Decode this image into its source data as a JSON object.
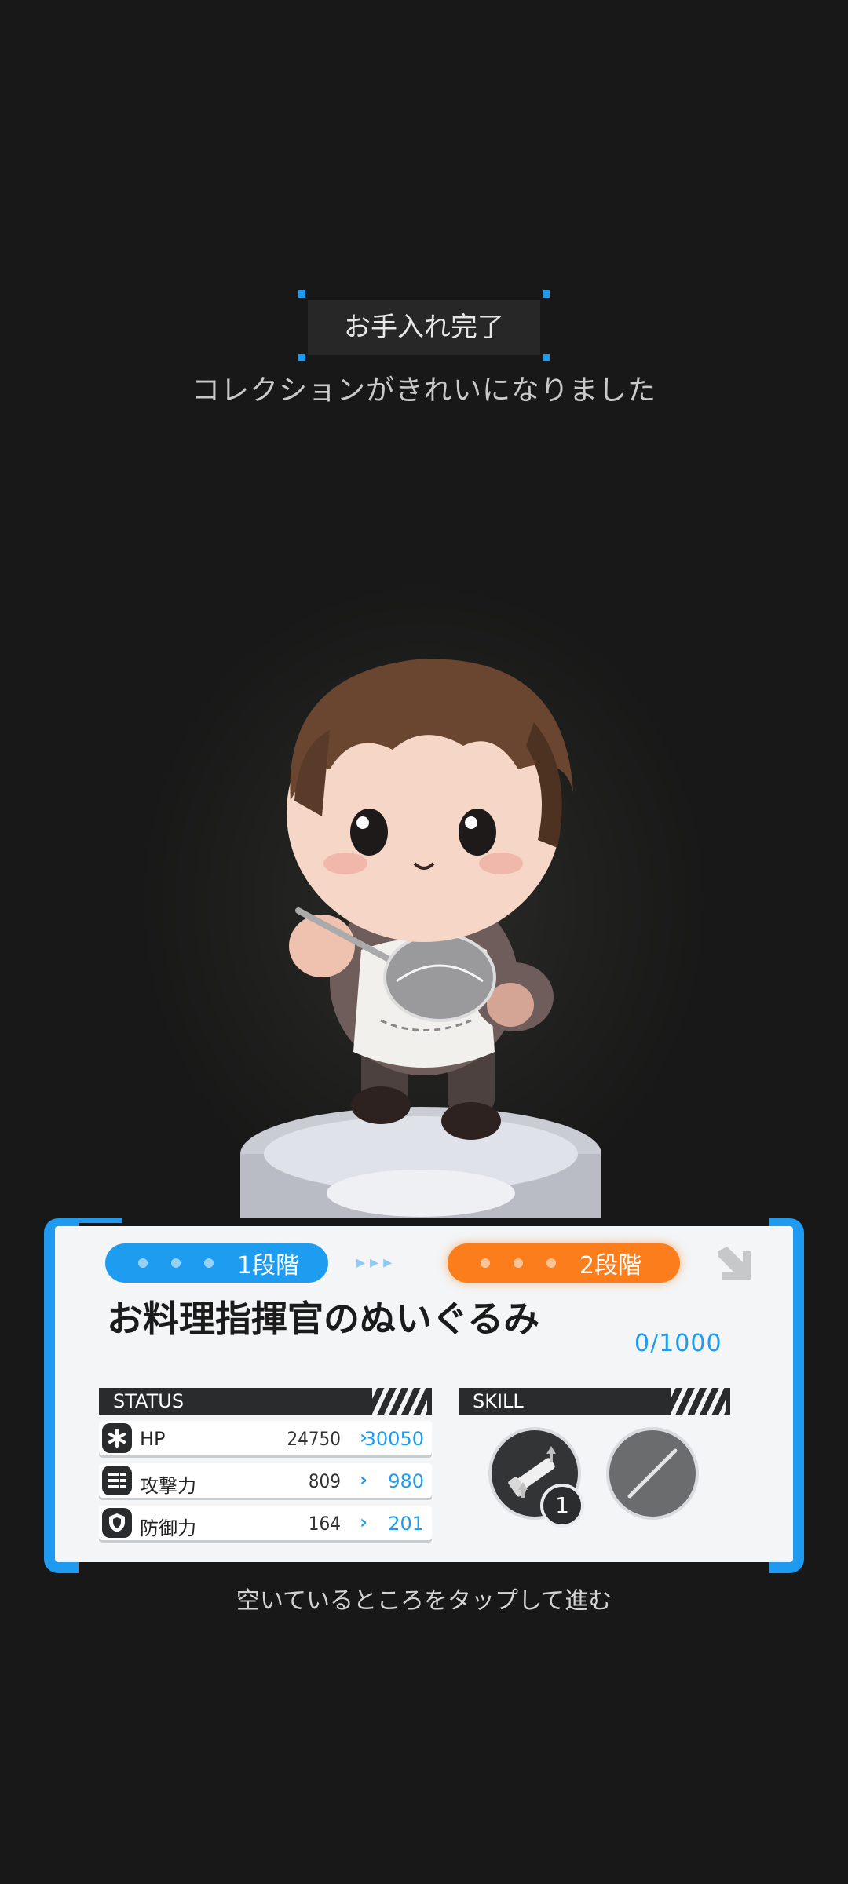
{
  "header": {
    "title": "お手入れ完了",
    "subtitle": "コレクションがきれいになりました"
  },
  "card": {
    "stage_current": "1段階",
    "stage_next": "2段階",
    "character_name": "お料理指揮官のぬいぐるみ",
    "progress": "0/1000",
    "status_header": "STATUS",
    "skill_header": "SKILL",
    "stats": [
      {
        "icon": "asterisk-icon",
        "label": "HP",
        "old": "24750",
        "new": "30050"
      },
      {
        "icon": "list-icon",
        "label": "攻撃力",
        "old": "809",
        "new": "980"
      },
      {
        "icon": "shield-icon",
        "label": "防御力",
        "old": "164",
        "new": "201"
      }
    ],
    "skill_level": "1"
  },
  "footer": {
    "tap_hint": "空いているところをタップして進む"
  },
  "colors": {
    "accent_blue": "#1d9cf0",
    "accent_orange": "#fb7d1b",
    "background": "#171817"
  }
}
